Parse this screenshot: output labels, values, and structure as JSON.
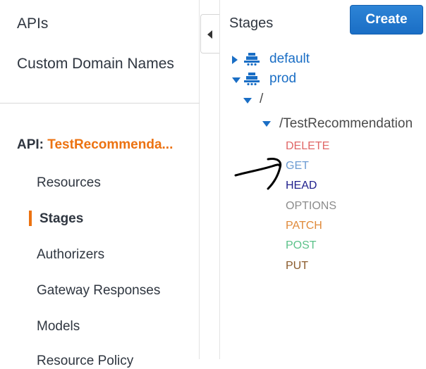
{
  "sidebar": {
    "apis_label": "APIs",
    "custom_domains_label": "Custom Domain Names",
    "api_prefix": "API:",
    "api_name": "TestRecommenda...",
    "items": [
      {
        "label": "Resources"
      },
      {
        "label": "Stages"
      },
      {
        "label": "Authorizers"
      },
      {
        "label": "Gateway Responses"
      },
      {
        "label": "Models"
      },
      {
        "label": "Resource Policy"
      }
    ],
    "active_item": "Stages"
  },
  "main": {
    "title": "Stages",
    "create_label": "Create",
    "stages": [
      {
        "name": "default",
        "expanded": false
      },
      {
        "name": "prod",
        "expanded": true
      }
    ],
    "paths": [
      {
        "path": "/",
        "expanded": true
      },
      {
        "path": "/TestRecommendation",
        "expanded": true
      }
    ],
    "methods": [
      {
        "name": "DELETE",
        "color": "#e06666"
      },
      {
        "name": "GET",
        "color": "#6c9bd2"
      },
      {
        "name": "HEAD",
        "color": "#1e1e8c"
      },
      {
        "name": "OPTIONS",
        "color": "#8c8c8c"
      },
      {
        "name": "PATCH",
        "color": "#e08a3a"
      },
      {
        "name": "POST",
        "color": "#5cc28a"
      },
      {
        "name": "PUT",
        "color": "#8a5a2b"
      }
    ]
  },
  "colors": {
    "accent": "#ec7211",
    "link": "#1a6ec5",
    "button": "#1a6ec5"
  },
  "annotation": {
    "arrow_points_to": "GET"
  }
}
